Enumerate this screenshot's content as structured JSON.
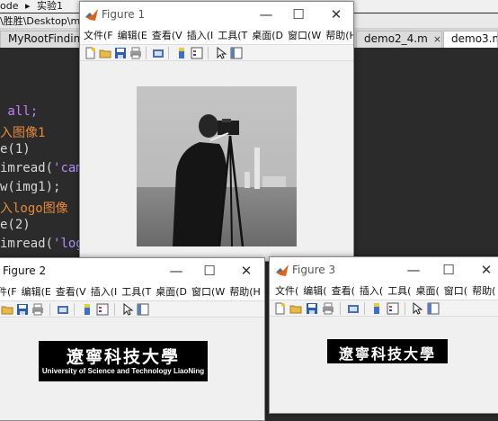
{
  "editor": {
    "top_menu": [
      "ode",
      "▸",
      "实验1"
    ],
    "path": "\\胜胜\\Desktop\\ma",
    "tabs": [
      {
        "label": "MyRootFinding.",
        "active": false
      },
      {
        "label": "demo2_4.m",
        "active": false
      },
      {
        "label": "demo3.m",
        "active": true
      }
    ],
    "tab_close": "×",
    "code_lines": [
      {
        "text": " all;",
        "cls": "c-kw"
      },
      {
        "text": "入图像1",
        "cls": "c-cmt"
      },
      {
        "text": "e(1)",
        "cls": "c-white"
      },
      {
        "pre": "imread(",
        "str": "'came",
        "cls": "c-white"
      },
      {
        "text": "w(img1);",
        "cls": "c-white"
      },
      {
        "text": "入logo图像",
        "cls": "c-cmt"
      },
      {
        "text": "e(2)",
        "cls": "c-white"
      },
      {
        "pre": "imread(",
        "str": "'logo",
        "cls": "c-white"
      }
    ]
  },
  "windows": {
    "figure1": {
      "title": "Figure 1",
      "menu": [
        "文件(F",
        "编辑(E",
        "查看(V",
        "插入(I",
        "工具(T",
        "桌面(D",
        "窗口(W",
        "帮助(H",
        "↘"
      ],
      "image_name": "cameraman"
    },
    "figure2": {
      "title": "Figure 2",
      "menu": [
        "件(F",
        "编辑(E",
        "查看(V",
        "插入(I",
        "工具(T",
        "桌面(D",
        "窗口(W",
        "帮助(H",
        "↘"
      ],
      "logo_cn": "遼寧科技大學",
      "logo_en": "University of Science and Technology LiaoNing"
    },
    "figure3": {
      "title": "Figure 3",
      "menu": [
        "文件(",
        "编辑(",
        "查看(",
        "插入(",
        "工具(",
        "桌面(",
        "窗口(",
        "帮助(",
        "↑"
      ],
      "logo_cn": "遼寧科技大學"
    },
    "controls": {
      "minimize": "—",
      "maximize": "☐",
      "close": "✕"
    }
  },
  "toolbar_icons": [
    "new-file-icon",
    "open-folder-icon",
    "save-icon",
    "print-icon",
    "print-preview-icon",
    "colorbar-icon",
    "legend-icon",
    "pointer-icon",
    "property-editor-icon"
  ],
  "colors": {
    "accent_blue": "#1f5fbf",
    "editor_bg": "#2b2b2b",
    "comment_orange": "#e8893a",
    "keyword_purple": "#c77dff"
  }
}
